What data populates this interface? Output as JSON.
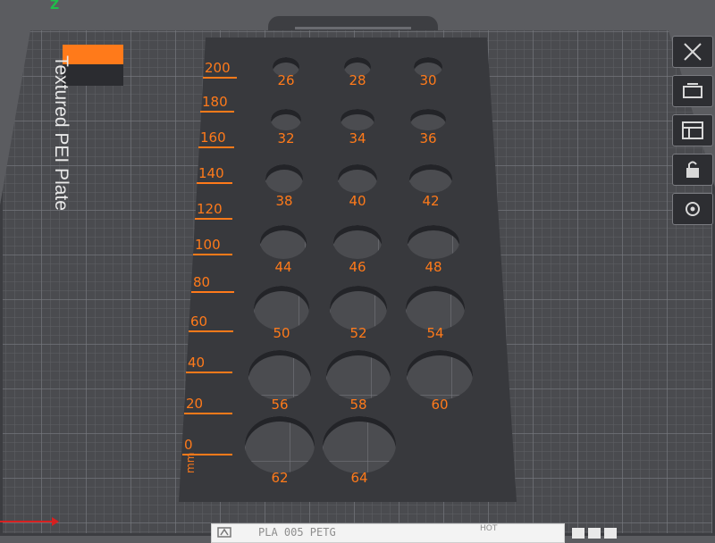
{
  "axes": {
    "z_label": "Z"
  },
  "plate": {
    "name": "Textured PEI Plate",
    "swatch_colors": {
      "top": "#ff7a1a",
      "bottom": "#2b2c30"
    }
  },
  "model": {
    "color": "#ff7a1a",
    "ruler": {
      "unit": "mm",
      "labels": [
        "200",
        "180",
        "160",
        "140",
        "120",
        "100",
        "80",
        "60",
        "40",
        "20",
        "0"
      ]
    },
    "holes": [
      "26",
      "28",
      "30",
      "32",
      "34",
      "36",
      "38",
      "40",
      "42",
      "44",
      "46",
      "48",
      "50",
      "52",
      "54",
      "56",
      "58",
      "60",
      "62",
      "64"
    ]
  },
  "toolbar": {
    "buttons": [
      {
        "icon": "close-x-icon"
      },
      {
        "icon": "auto-orient-icon"
      },
      {
        "icon": "arrange-icon"
      },
      {
        "icon": "lock-icon"
      },
      {
        "icon": "plate-settings-icon"
      }
    ]
  },
  "status_bar": {
    "filament": "PLA 005 PETG",
    "hot_label": "HOT"
  }
}
